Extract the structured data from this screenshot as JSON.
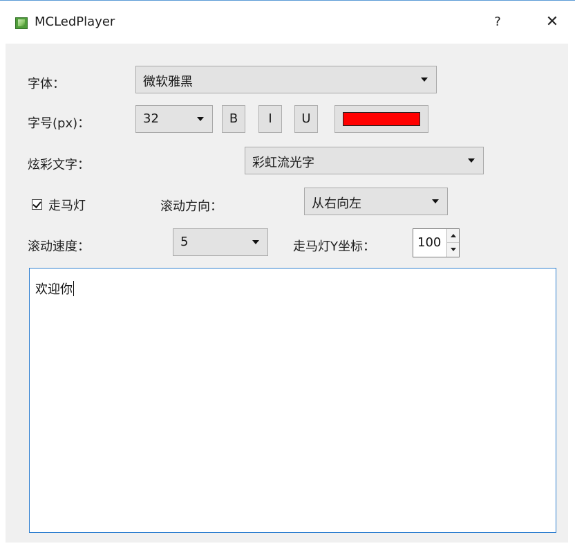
{
  "window": {
    "title": "MCLedPlayer",
    "help_label": "?",
    "close_label": "✕"
  },
  "font_row": {
    "label": "字体：",
    "value": "微软雅黑"
  },
  "size_row": {
    "label": "字号(px)：",
    "value": "32",
    "bold_label": "B",
    "italic_label": "I",
    "underline_label": "U",
    "text_color": "#ff0000"
  },
  "effect_row": {
    "label": "炫彩文字：",
    "value": "彩虹流光字"
  },
  "marquee_row": {
    "checkbox_label": "走马灯",
    "checked": true,
    "direction_label": "滚动方向：",
    "direction_value": "从右向左"
  },
  "speed_row": {
    "speed_label": "滚动速度：",
    "speed_value": "5",
    "y_label": "走马灯Y坐标：",
    "y_value": "100"
  },
  "editor": {
    "text": "欢迎你"
  }
}
